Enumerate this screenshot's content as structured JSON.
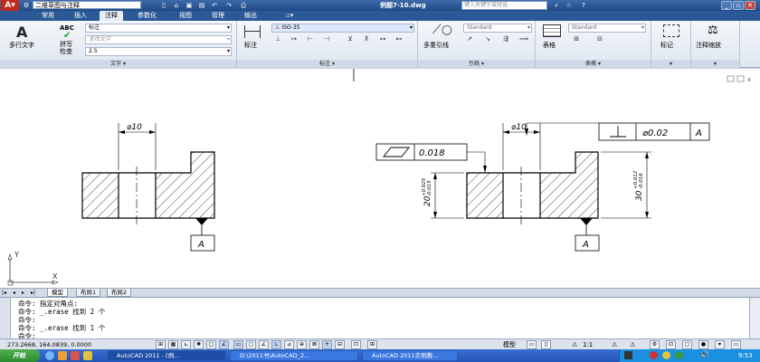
{
  "window": {
    "workspace": "二维草图与注释",
    "doc_title": "例题7-10.dwg",
    "search_placeholder": "键入关键字或短语",
    "help_icon": "?"
  },
  "tabs": [
    "常用",
    "插入",
    "注释",
    "参数化",
    "视图",
    "管理",
    "输出"
  ],
  "ribbon": {
    "text_panel": {
      "title": "文字",
      "multiline_text": "多行文字",
      "spell_check": "拼写\n检查",
      "abc": "ABC",
      "style_value": "标注",
      "find_placeholder": "查找文字",
      "height_value": "2.5"
    },
    "dim_panel": {
      "title": "标注",
      "dim_label": "标注",
      "style_value": "ISO-35"
    },
    "leader_panel": {
      "title": "引线",
      "mleader_label": "多重引线",
      "style_value": "Standard"
    },
    "table_panel": {
      "title": "表格",
      "table_label": "表格",
      "style_value": "Standard"
    },
    "markup_panel": {
      "label": "标记"
    },
    "scale_panel": {
      "label": "注释缩放"
    }
  },
  "drawing": {
    "left_view": {
      "diameter": "⌀10",
      "datum": "A"
    },
    "right_view": {
      "diameter": "⌀10",
      "datum": "A",
      "flatness": "0.018",
      "position_tol": "⌀0.02",
      "position_datum": "A",
      "dim_left_base": "20",
      "dim_left_upper": "+0.025",
      "dim_left_lower": "-0.015",
      "dim_right_base": "30",
      "dim_right_upper": "+0.012",
      "dim_right_lower": "-0.016"
    },
    "ucs_y": "Y",
    "ucs_x": "X"
  },
  "layout_tabs": [
    "模型",
    "布局1",
    "布局2"
  ],
  "command_lines": [
    "命令: 指定对角点:",
    "命令: _.erase 找到 2 个",
    "命令:",
    "命令: _.erase 找到 1 个",
    "命令:"
  ],
  "status": {
    "coords": "273.2668, 164.0839, 0.0000",
    "model": "模型",
    "scale": "1:1"
  },
  "taskbar": {
    "start": "开始",
    "tasks": [
      "AutoCAD 2011 - [例...",
      "D:\\2011书\\AutoCAD_2...",
      "AutoCAD 2011实例教..."
    ],
    "clock": "9:53"
  }
}
